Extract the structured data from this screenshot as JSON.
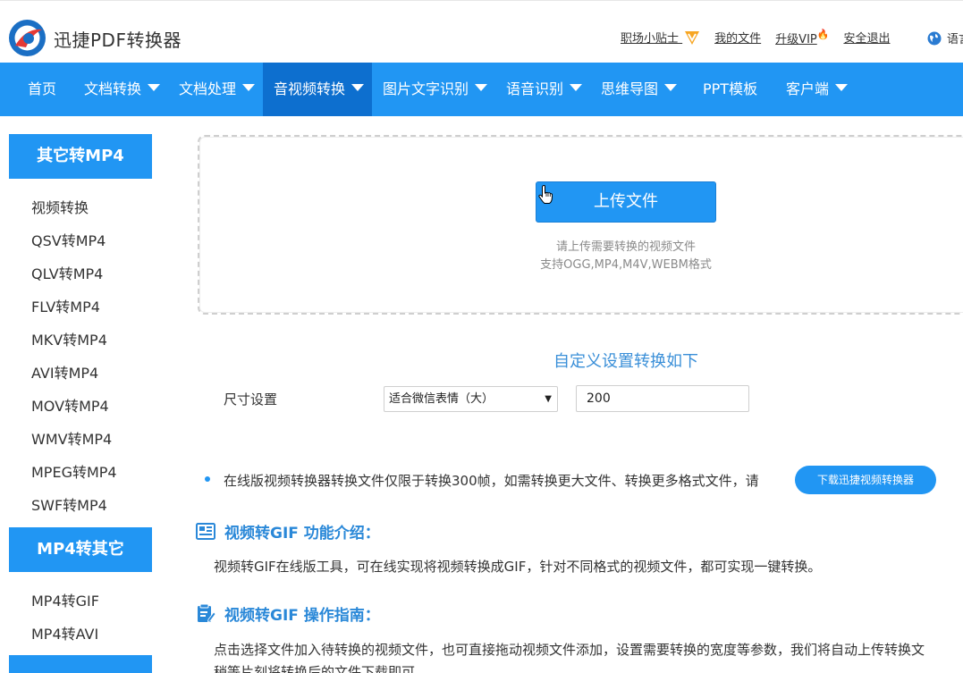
{
  "brand": {
    "name": "迅捷PDF转换器"
  },
  "toplinks": {
    "tips": "职场小贴士",
    "my_files": "我的文件",
    "upgrade_vip": "升级VIP",
    "logout": "安全退出",
    "language": "语言"
  },
  "nav": {
    "items": [
      {
        "label": "首页"
      },
      {
        "label": "文档转换"
      },
      {
        "label": "文档处理"
      },
      {
        "label": "音视频转换"
      },
      {
        "label": "图片文字识别"
      },
      {
        "label": "语音识别"
      },
      {
        "label": "思维导图"
      },
      {
        "label": "PPT模板"
      },
      {
        "label": "客户端"
      }
    ]
  },
  "sidebar": {
    "group1_title": "其它转MP4",
    "group1_items": [
      "视频转换",
      "QSV转MP4",
      "QLV转MP4",
      "FLV转MP4",
      "MKV转MP4",
      "AVI转MP4",
      "MOV转MP4",
      "WMV转MP4",
      "MPEG转MP4",
      "SWF转MP4"
    ],
    "group2_title": "MP4转其它",
    "group2_items": [
      "MP4转GIF",
      "MP4转AVI"
    ]
  },
  "upload": {
    "button_label": "上传文件",
    "hint_line1": "请上传需要转换的视频文件",
    "hint_line2": "支持OGG,MP4,M4V,WEBM格式"
  },
  "settings": {
    "title": "自定义设置转换如下",
    "size_label": "尺寸设置",
    "size_select_value": "适合微信表情（大）",
    "size_input_value": "200"
  },
  "notice": {
    "text": "在线版视频转换器转换文件仅限于转换300帧，如需转换更大文件、转换更多格式文件，请",
    "download_button": "下载迅捷视频转换器"
  },
  "intro": {
    "title": "视频转GIF 功能介绍：",
    "text": "视频转GIF在线版工具，可在线实现将视频转换成GIF，针对不同格式的视频文件，都可实现一键转换。"
  },
  "guide": {
    "title": "视频转GIF 操作指南：",
    "text_line1": "点击选择文件加入待转换的视频文件，也可直接拖动视频文件添加，设置需要转换的宽度等参数，我们将自动上传转换文",
    "text_line2": "稍等片刻将转换后的文件下载即可"
  },
  "icons": {
    "brand_logo": "brand-logo-icon",
    "vip_badge": "vip-badge-icon",
    "globe": "globe-icon",
    "cursor": "hand-cursor-icon",
    "intro": "news-icon",
    "guide": "guide-icon"
  },
  "colors": {
    "primary": "#2196f3",
    "nav_active": "#0d6fcf",
    "heading_blue": "#2a88d8"
  }
}
